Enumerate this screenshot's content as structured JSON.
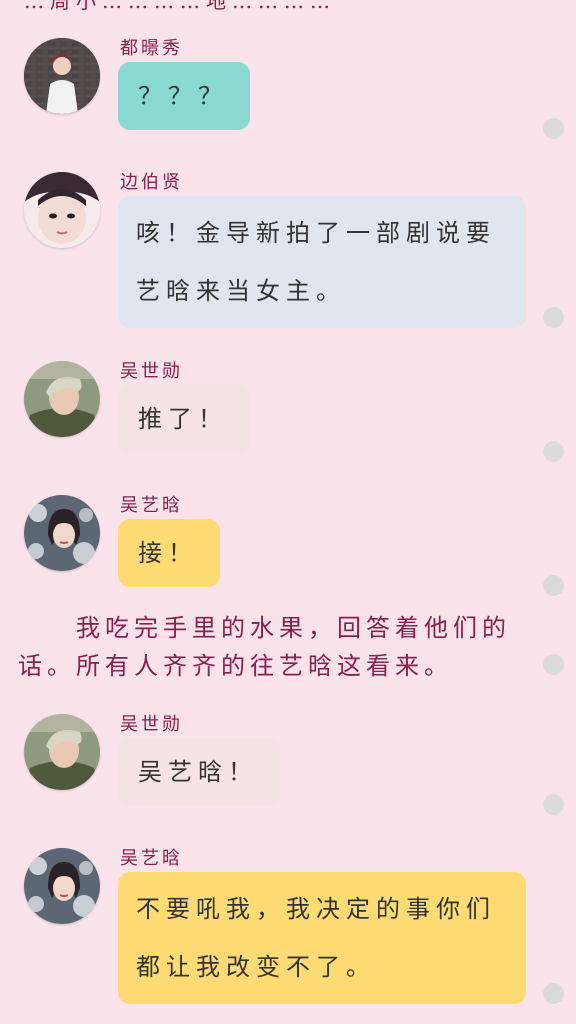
{
  "top_fragment": "…周小…………地…………",
  "colors": {
    "background": "#fbe3ec",
    "name_text": "#8a1f4c",
    "narration_text": "#8a1f4c",
    "bubble_teal": "#8ad9d0",
    "bubble_gray": "#e0e5ee",
    "bubble_pink": "#f5e3e6",
    "bubble_yellow": "#ffdc73",
    "side_dot": "#dbdbdb"
  },
  "messages": [
    {
      "avatar_icon": "avatar-boy-white-shirt",
      "name": "都暻秀",
      "text": "？？？",
      "bubble_color": "#8ad9d0"
    },
    {
      "avatar_icon": "avatar-boy-closeup",
      "name": "边伯贤",
      "text": "咳！金导新拍了一部剧说要艺晗来当女主。",
      "bubble_color": "#e0e5ee"
    },
    {
      "avatar_icon": "avatar-boy-blond",
      "name": "吴世勋",
      "text": "推了！",
      "bubble_color": "#f5e3e6"
    },
    {
      "avatar_icon": "avatar-girl-flowers",
      "name": "吴艺晗",
      "text": "接！",
      "bubble_color": "#ffdc73"
    },
    {
      "avatar_icon": "avatar-boy-blond",
      "name": "吴世勋",
      "text": "吴艺晗！",
      "bubble_color": "#f5e3e6"
    },
    {
      "avatar_icon": "avatar-girl-flowers",
      "name": "吴艺晗",
      "text": "不要吼我，我决定的事你们都让我改变不了。",
      "bubble_color": "#ffdc73"
    }
  ],
  "narration": "我吃完手里的水果，回答着他们的话。所有人齐齐的往艺晗这看来。"
}
